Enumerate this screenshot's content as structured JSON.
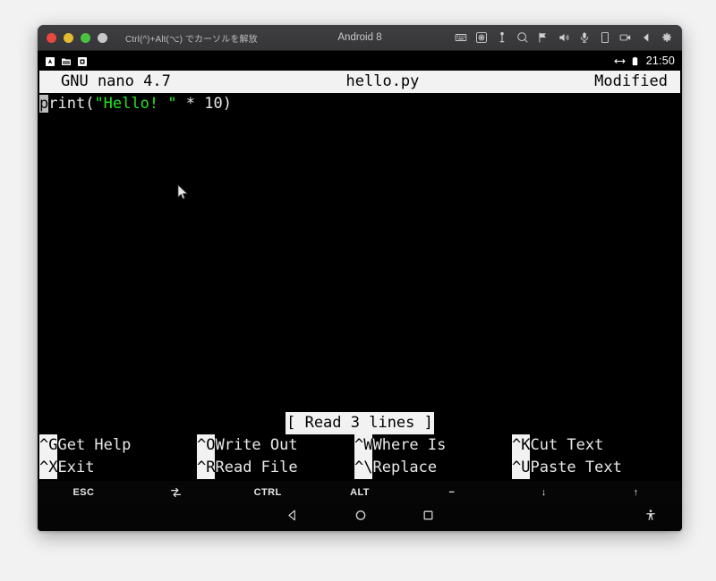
{
  "window": {
    "title": "Android 8",
    "hint": "Ctrl(^)+Alt(⌥) でカーソルを解放",
    "traffic_lights": [
      {
        "name": "close-button",
        "color": "#e8483f"
      },
      {
        "name": "minimize-button",
        "color": "#e3bc2f"
      },
      {
        "name": "zoom-button",
        "color": "#4cc243"
      },
      {
        "name": "fullscreen-button",
        "color": "#c8c8c8"
      }
    ],
    "toolbar_icons": [
      "keyboard-icon",
      "screenshot-icon",
      "usb-icon",
      "zoom-icon",
      "location-icon",
      "volume-icon",
      "microphone-icon",
      "rotate-icon",
      "record-icon",
      "back-icon",
      "settings-gear-icon"
    ]
  },
  "android_status_bar": {
    "left_icons": [
      "app-notification-icon",
      "folder-notification-icon",
      "screenshot-notification-icon"
    ],
    "right_icons": [
      "network-transfer-icon",
      "battery-icon"
    ],
    "clock": "21:50"
  },
  "nano": {
    "version": "GNU nano 4.7",
    "filename": "hello.py",
    "state": "Modified",
    "code": {
      "cursor_char": "p",
      "before": "rint(",
      "string": "\"Hello! \"",
      "after": " * 10)"
    },
    "status_message": "[ Read 3 lines ]",
    "shortcuts": [
      [
        {
          "key": "^G",
          "label": "Get Help"
        },
        {
          "key": "^O",
          "label": "Write Out"
        },
        {
          "key": "^W",
          "label": "Where Is"
        },
        {
          "key": "^K",
          "label": "Cut Text"
        }
      ],
      [
        {
          "key": "^X",
          "label": "Exit"
        },
        {
          "key": "^R",
          "label": "Read File"
        },
        {
          "key": "^\\",
          "label": "Replace"
        },
        {
          "key": "^U",
          "label": "Paste Text"
        }
      ]
    ]
  },
  "key_toolbar": [
    {
      "name": "esc-key",
      "label": "ESC",
      "icon": null
    },
    {
      "name": "tab-key",
      "label": "",
      "icon": "tab-icon"
    },
    {
      "name": "ctrl-key",
      "label": "CTRL",
      "icon": null
    },
    {
      "name": "alt-key",
      "label": "ALT",
      "icon": null
    },
    {
      "name": "minus-key",
      "label": "−",
      "icon": null
    },
    {
      "name": "arrow-down-key",
      "label": "↓",
      "icon": null
    },
    {
      "name": "arrow-up-key",
      "label": "↑",
      "icon": null
    }
  ],
  "nav_bar": {
    "back": "back-nav-icon",
    "home": "home-nav-icon",
    "recents": "recents-nav-icon",
    "accessibility": "accessibility-icon"
  },
  "colors": {
    "terminal_bg": "#000000",
    "terminal_fg": "#e8e8e8",
    "string_green": "#23e323",
    "inverse_bg": "#f2f2f2",
    "titlebar_bg": "#3a3a3d",
    "desktop_bg": "#f2f2f2"
  }
}
